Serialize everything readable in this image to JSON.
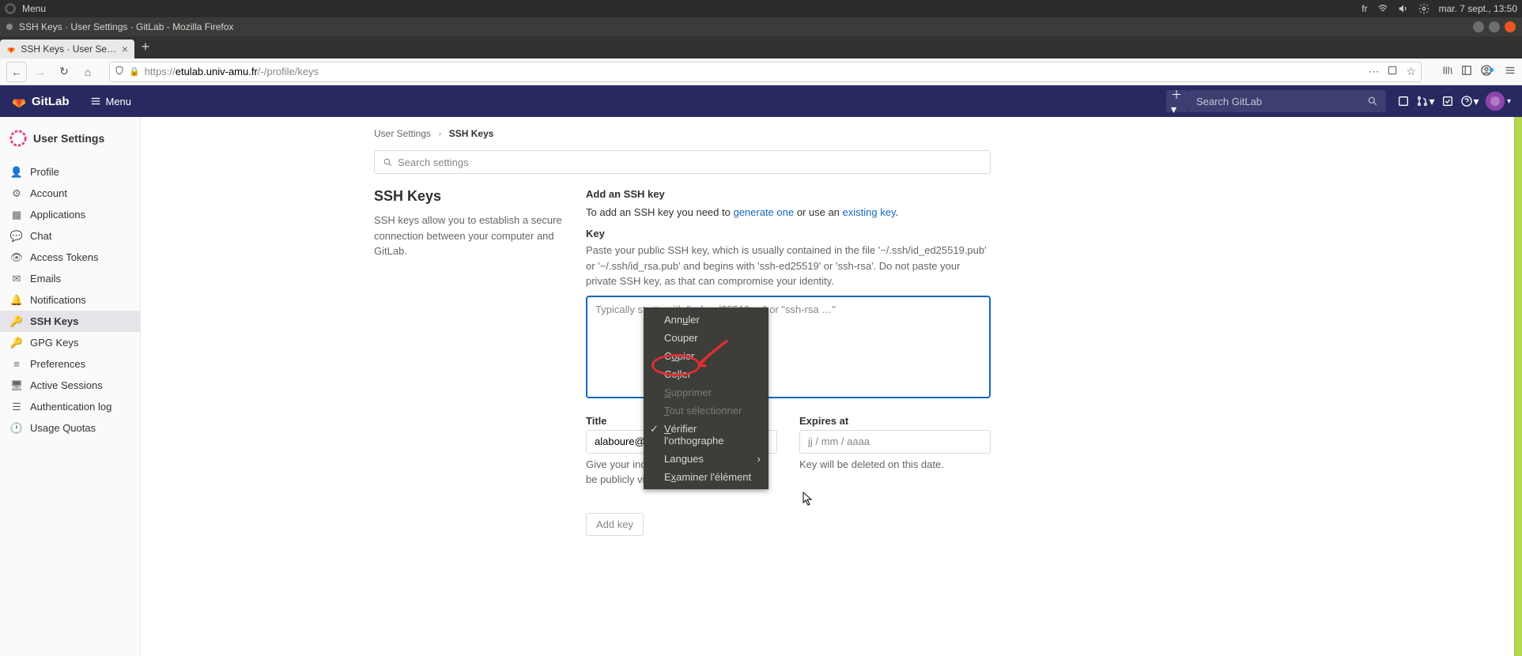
{
  "ubuntu": {
    "menu": "Menu",
    "lang": "fr",
    "date": "mar. 7 sept., 13:50"
  },
  "window": {
    "title": "SSH Keys · User Settings · GitLab - Mozilla Firefox"
  },
  "tab": {
    "title": "SSH Keys · User Settings"
  },
  "url": {
    "prefix": "https://",
    "host": "etulab.univ-amu.fr",
    "path": "/-/profile/keys"
  },
  "gitlab": {
    "brand": "GitLab",
    "menu_label": "Menu",
    "search_placeholder": "Search GitLab"
  },
  "sidebar": {
    "title": "User Settings",
    "items": [
      {
        "label": "Profile",
        "icon": "person"
      },
      {
        "label": "Account",
        "icon": "gear"
      },
      {
        "label": "Applications",
        "icon": "grid"
      },
      {
        "label": "Chat",
        "icon": "chat"
      },
      {
        "label": "Access Tokens",
        "icon": "eye"
      },
      {
        "label": "Emails",
        "icon": "mail"
      },
      {
        "label": "Notifications",
        "icon": "bell"
      },
      {
        "label": "SSH Keys",
        "icon": "key"
      },
      {
        "label": "GPG Keys",
        "icon": "key"
      },
      {
        "label": "Preferences",
        "icon": "sliders"
      },
      {
        "label": "Active Sessions",
        "icon": "session"
      },
      {
        "label": "Authentication log",
        "icon": "list"
      },
      {
        "label": "Usage Quotas",
        "icon": "clock"
      }
    ],
    "active_index": 7
  },
  "breadcrumb": {
    "root": "User Settings",
    "current": "SSH Keys"
  },
  "search_settings_placeholder": "Search settings",
  "left": {
    "heading": "SSH Keys",
    "desc": "SSH keys allow you to establish a secure connection between your computer and GitLab."
  },
  "right": {
    "add_title": "Add an SSH key",
    "add_help_before": "To add an SSH key you need to ",
    "link_generate": "generate one",
    "add_help_mid": " or use an ",
    "link_existing": "existing key",
    "add_help_end": ".",
    "key_label": "Key",
    "key_help": "Paste your public SSH key, which is usually contained in the file '~/.ssh/id_ed25519.pub' or '~/.ssh/id_rsa.pub' and begins with 'ssh-ed25519' or 'ssh-rsa'. Do not paste your private SSH key, as that can compromise your identity.",
    "key_placeholder": "Typically starts with \"ssh-ed25519 …\" or \"ssh-rsa …\"",
    "title_label": "Title",
    "title_value": "alaboure@V",
    "title_help": "Give your individual key a title. This will be publicly visible.",
    "expires_label": "Expires at",
    "expires_placeholder": "jj / mm / aaaa",
    "expires_help": "Key will be deleted on this date.",
    "add_btn": "Add key"
  },
  "context_menu": {
    "undo": "Annuler",
    "cut": "Couper",
    "copy": "Copier",
    "paste": "Coller",
    "delete": "Supprimer",
    "select_all": "Tout sélectionner",
    "spellcheck": "Vérifier l'orthographe",
    "languages": "Langues",
    "inspect": "Examiner l'élément"
  }
}
